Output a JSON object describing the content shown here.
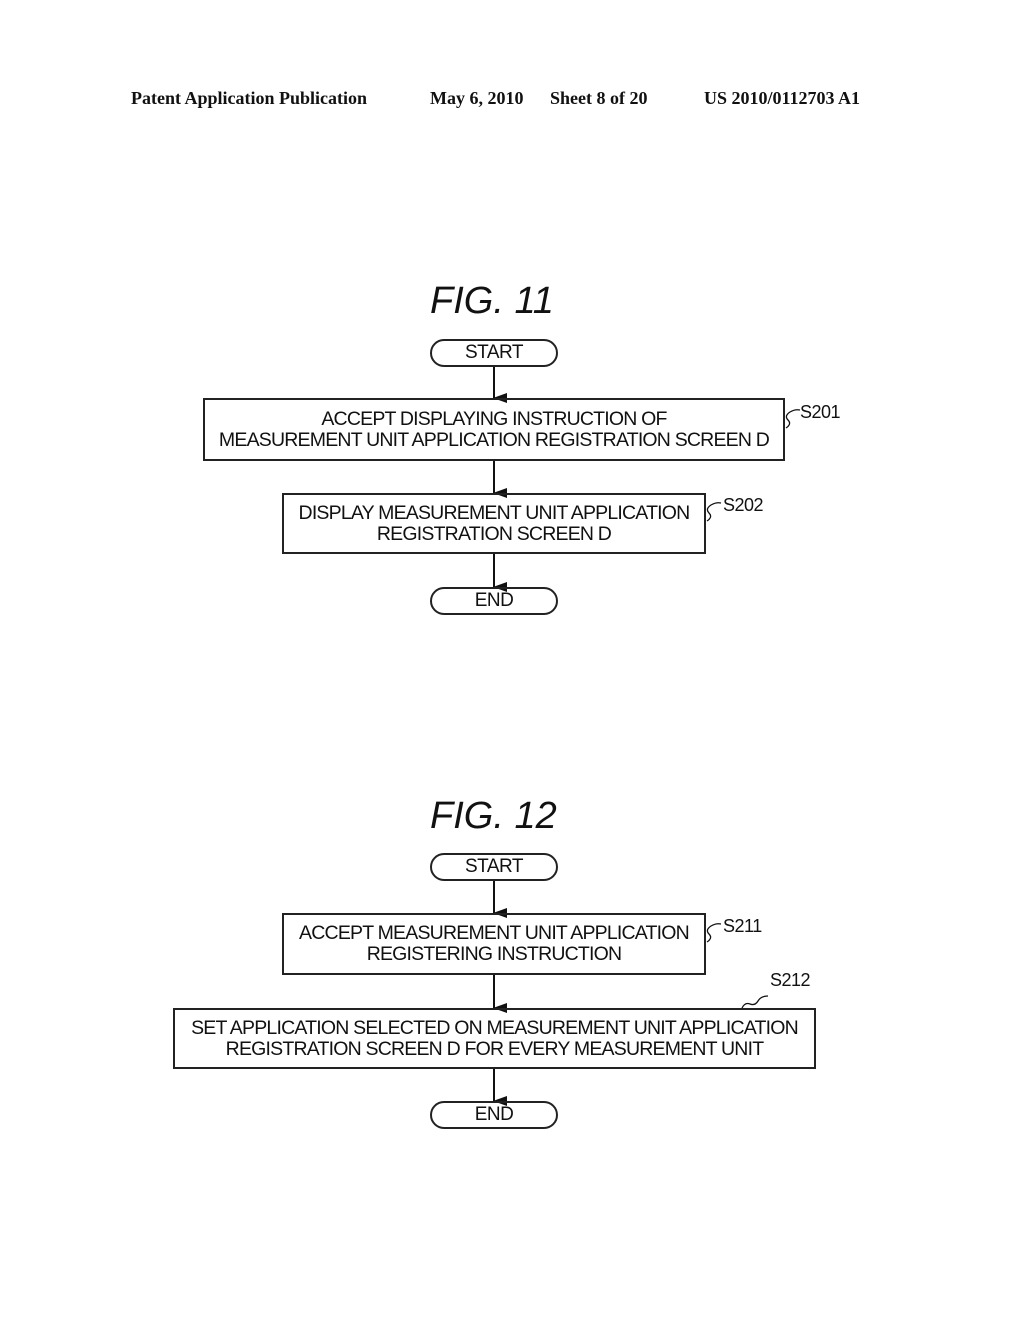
{
  "header": {
    "publication_type": "Patent Application Publication",
    "date": "May 6, 2010",
    "sheet": "Sheet 8 of 20",
    "number": "US 2010/0112703 A1"
  },
  "figures": [
    {
      "title": "FIG. 11",
      "start_label": "START",
      "end_label": "END",
      "steps": [
        {
          "id": "S201",
          "lines": [
            "ACCEPT DISPLAYING INSTRUCTION OF",
            "MEASUREMENT UNIT APPLICATION REGISTRATION SCREEN D"
          ]
        },
        {
          "id": "S202",
          "lines": [
            "DISPLAY MEASUREMENT UNIT APPLICATION",
            "REGISTRATION SCREEN D"
          ]
        }
      ]
    },
    {
      "title": "FIG. 12",
      "start_label": "START",
      "end_label": "END",
      "steps": [
        {
          "id": "S211",
          "lines": [
            "ACCEPT MEASUREMENT UNIT APPLICATION",
            "REGISTERING INSTRUCTION"
          ]
        },
        {
          "id": "S212",
          "lines": [
            "SET APPLICATION SELECTED ON MEASUREMENT UNIT APPLICATION",
            "REGISTRATION SCREEN D FOR EVERY MEASUREMENT UNIT"
          ]
        }
      ]
    }
  ]
}
